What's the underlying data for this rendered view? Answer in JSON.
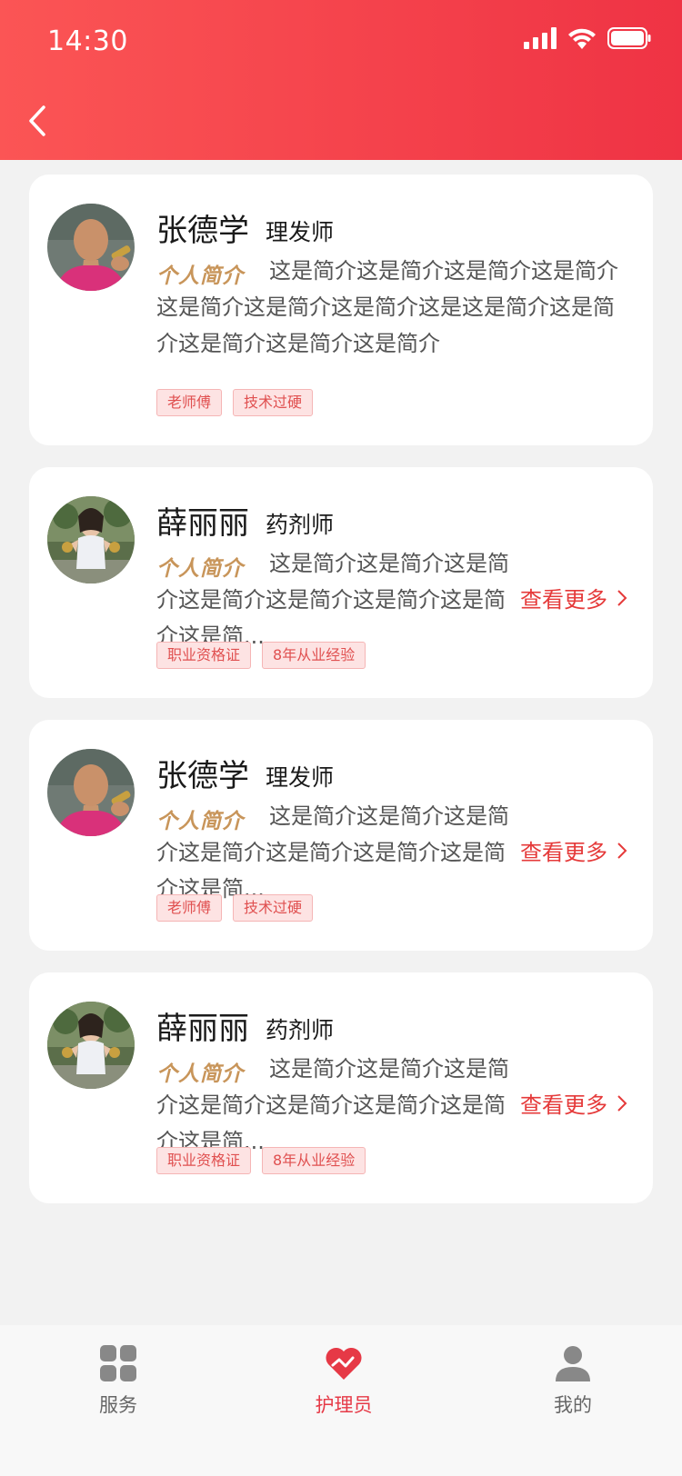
{
  "status_bar": {
    "time": "14:30"
  },
  "intro_label": "个人简介",
  "more_label": "查看更多",
  "cards": [
    {
      "name": "张德学",
      "role": "理发师",
      "intro": "这是简介这是简介这是简介这是简介这是简介这是简介这是简介这是这是简介这是简介这是简介这是简介这是简介",
      "tags": [
        "老师傅",
        "技术过硬"
      ]
    },
    {
      "name": "薛丽丽",
      "role": "药剂师",
      "intro": "这是简介这是简介这是简介这是简介这是简介这是简介这是简介这是简...",
      "tags": [
        "职业资格证",
        "8年从业经验"
      ]
    },
    {
      "name": "张德学",
      "role": "理发师",
      "intro": "这是简介这是简介这是简介这是简介这是简介这是简介这是简介这是简...",
      "tags": [
        "老师傅",
        "技术过硬"
      ]
    },
    {
      "name": "薛丽丽",
      "role": "药剂师",
      "intro": "这是简介这是简介这是简介这是简介这是简介这是简介这是简介这是简...",
      "tags": [
        "职业资格证",
        "8年从业经验"
      ]
    }
  ],
  "tabbar": {
    "items": [
      {
        "label": "服务",
        "icon": "grid-icon"
      },
      {
        "label": "护理员",
        "icon": "heart-icon"
      },
      {
        "label": "我的",
        "icon": "user-icon"
      }
    ],
    "active_index": 1
  },
  "colors": {
    "header_start": "#fb5555",
    "header_end": "#ef3344",
    "accent": "#e53a3a",
    "intro_label": "#c8955a"
  }
}
